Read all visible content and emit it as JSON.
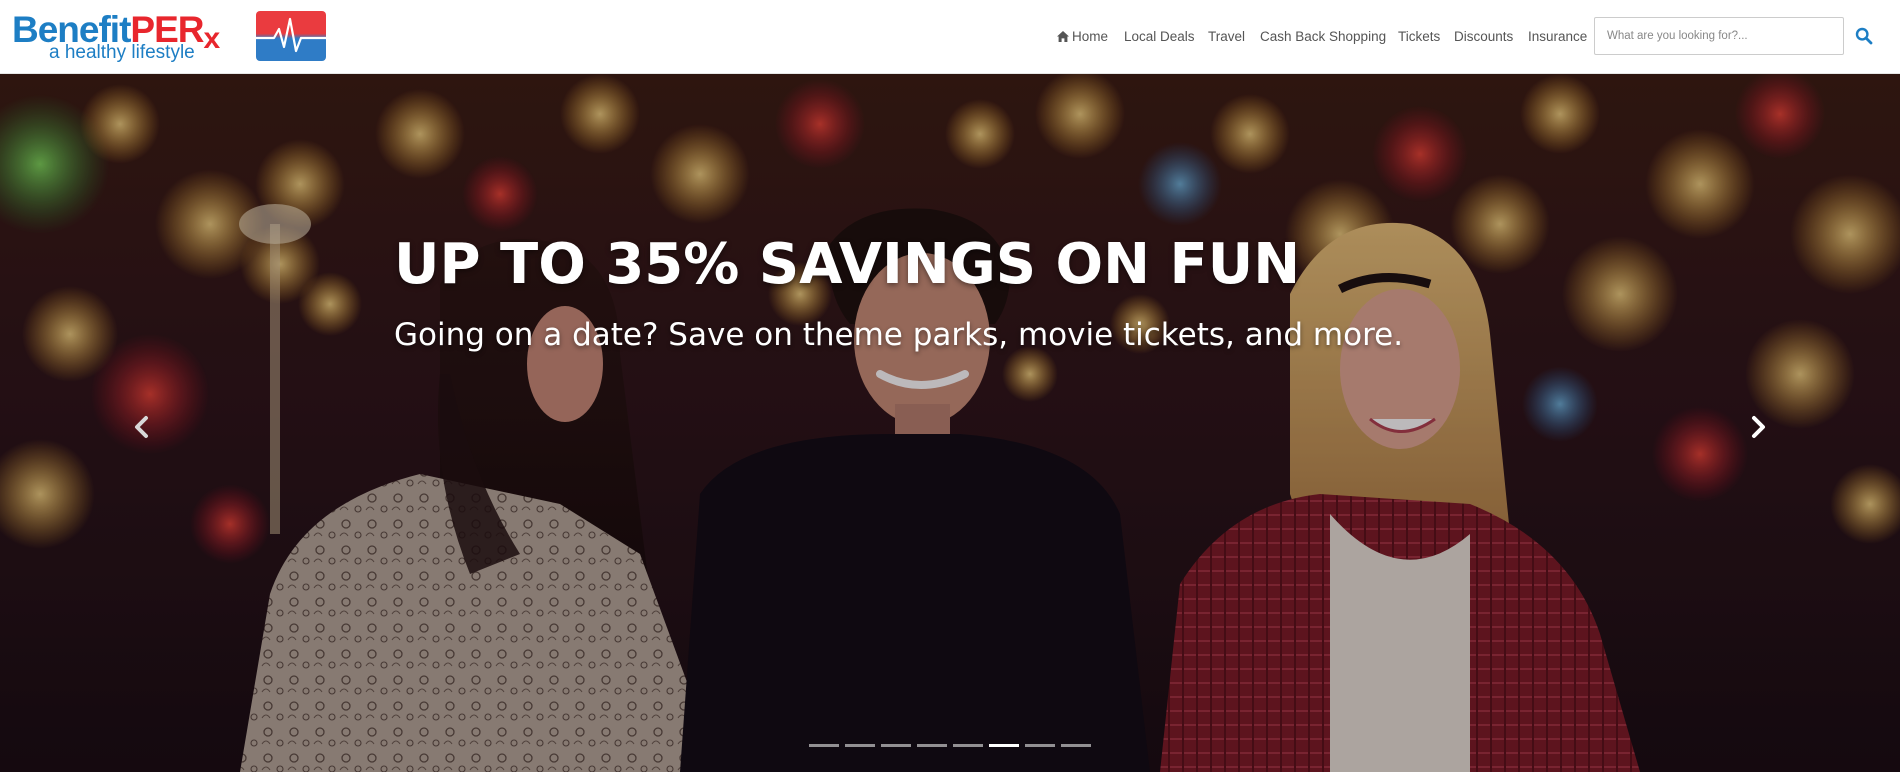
{
  "brand": {
    "logo_part_a": "Benefit",
    "logo_part_b": "PER",
    "logo_part_c": "x",
    "tagline": "a healthy lifestyle",
    "blue": "#1d7ec4",
    "red": "#e8262d"
  },
  "nav": {
    "items": [
      {
        "label": "Home",
        "icon": "home-icon"
      },
      {
        "label": "Local Deals"
      },
      {
        "label": "Travel"
      },
      {
        "label": "Cash Back Shopping"
      },
      {
        "label": "Tickets"
      },
      {
        "label": "Discounts"
      },
      {
        "label": "Insurance"
      }
    ]
  },
  "search": {
    "placeholder": "What are you looking for?...",
    "value": "",
    "icon": "search-icon",
    "icon_color": "#1d7ec4"
  },
  "hero": {
    "headline": "UP TO 35% SAVINGS ON FUN",
    "subline": "Going on a date? Save on theme parks, movie tickets, and more.",
    "prev_icon": "chevron-left-icon",
    "next_icon": "chevron-right-icon"
  },
  "carousel": {
    "slide_count": 8,
    "active_index": 5
  }
}
